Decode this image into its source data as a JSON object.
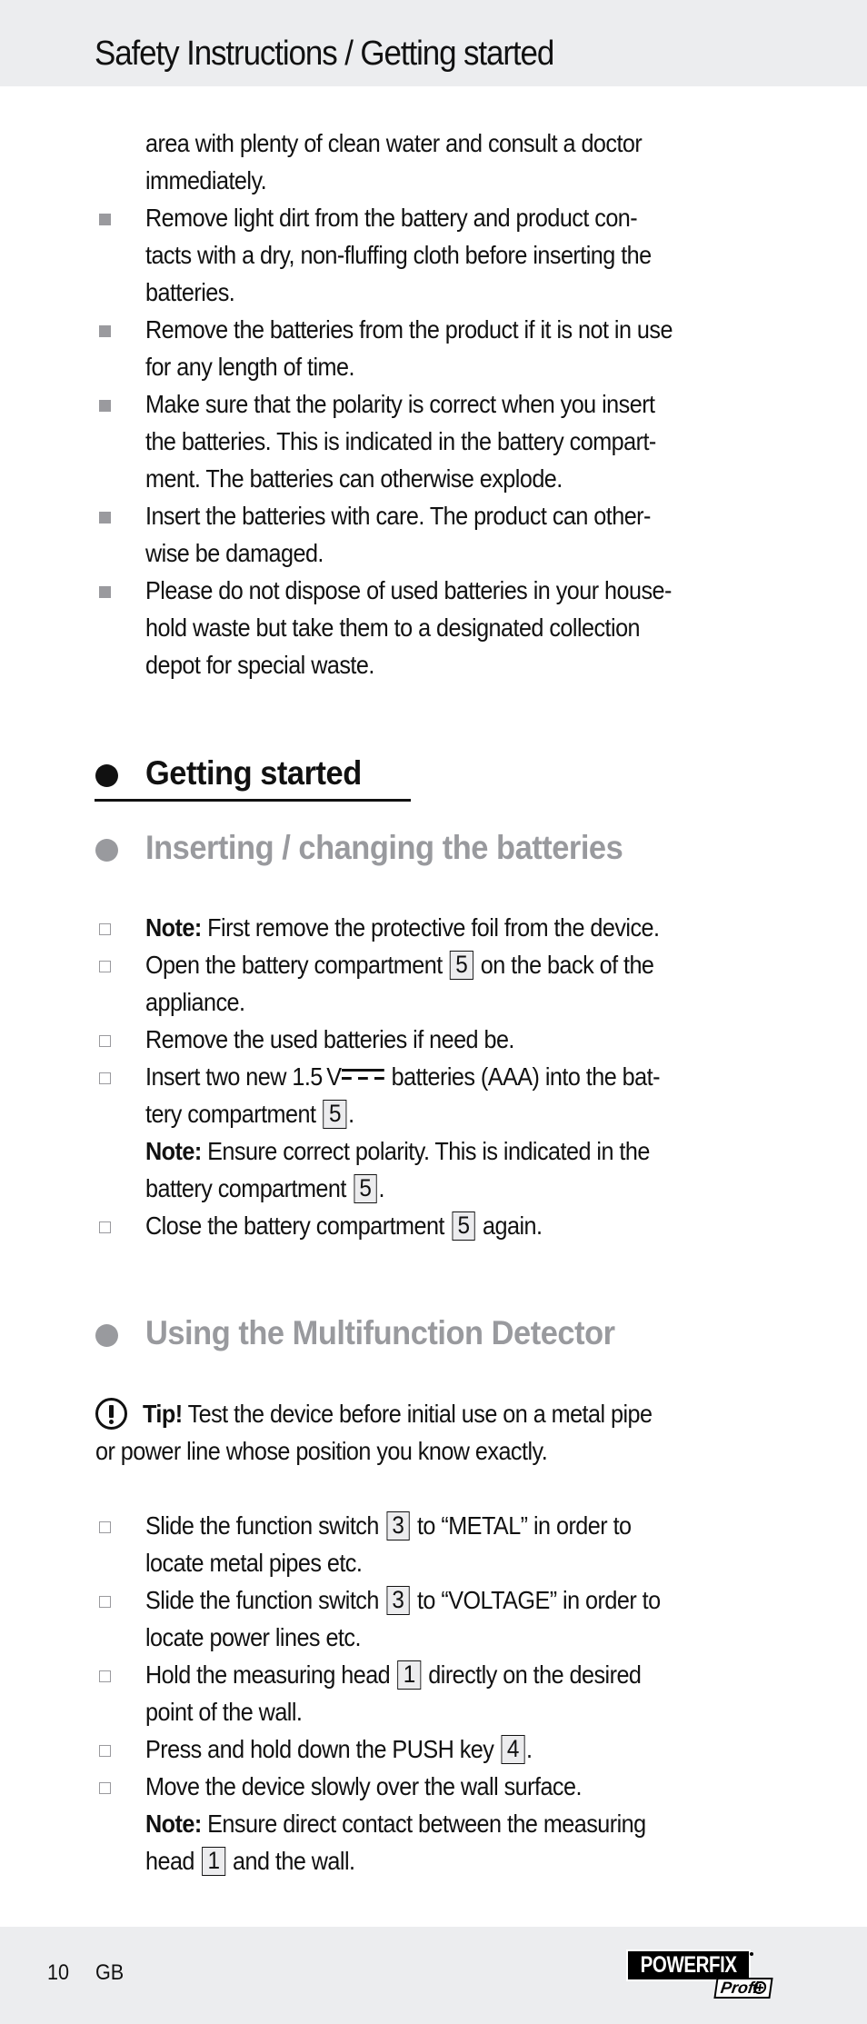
{
  "header": {
    "title": "Safety Instructions / Getting started"
  },
  "safety": {
    "continuation": {
      "lines": [
        "area with plenty of clean water and consult a doctor",
        "immediately."
      ]
    },
    "items": [
      {
        "lines": [
          "Remove light dirt from the battery and product con-",
          "tacts with a dry, non-fluffing cloth before inserting the",
          "batteries."
        ]
      },
      {
        "lines": [
          "Remove the batteries from the product if it is not in use",
          "for any length of time."
        ]
      },
      {
        "lines": [
          "Make sure that the polarity is correct when you insert",
          "the batteries. This is indicated in the battery compart-",
          "ment. The batteries can otherwise explode."
        ]
      },
      {
        "lines": [
          "Insert the batteries with care. The product can other-",
          "wise be damaged."
        ]
      },
      {
        "lines": [
          "Please do not dispose of used batteries in your house-",
          "hold waste but take them to a designated collection",
          "depot for special waste."
        ]
      }
    ]
  },
  "getting_started": {
    "heading": "Getting started"
  },
  "batteries": {
    "heading": "Inserting / changing the batteries",
    "note_label": "Note:",
    "step1_text": " First remove the protective foil from the device.",
    "step2_pre": "Open the battery compartment",
    "step2_ref": "5",
    "step2_post": "on the back of the",
    "step2_line2": "appliance.",
    "step3": "Remove the used batteries if need be.",
    "step4_pre": "Insert two new 1.5 V",
    "step4_post": "batteries (AAA) into the bat-",
    "step4_line2_pre": "tery compartment",
    "step4_ref": "5",
    "step4_line2_post": ".",
    "step4_note_label": "Note:",
    "step4_note_text": " Ensure correct polarity. This is indicated in the",
    "step4_note_line2_pre": "battery compartment",
    "step4_note_ref": "5",
    "step4_note_line2_post": ".",
    "step5_pre": "Close the battery compartment",
    "step5_ref": "5",
    "step5_post": "again."
  },
  "using": {
    "heading": "Using the Multifunction Detector",
    "tip_label": "Tip!",
    "tip_text": " Test the device before initial use on a metal pipe",
    "tip_line2": "or power line whose position you know exactly.",
    "step1_pre": "Slide the function switch",
    "step1_ref": "3",
    "step1_post": "to “METAL” in order to",
    "step1_line2": "locate metal pipes etc.",
    "step2_pre": "Slide the function switch",
    "step2_ref": "3",
    "step2_post": "to “VOLTAGE” in order to",
    "step2_line2": "locate power lines etc.",
    "step3_pre": "Hold the measuring head",
    "step3_ref": "1",
    "step3_post": "directly on the desired",
    "step3_line2": "point of the wall.",
    "step4_pre": "Press and hold down the PUSH key",
    "step4_ref": "4",
    "step4_post": ".",
    "step5": "Move the device slowly over the wall surface.",
    "step5_note_label": "Note:",
    "step5_note_text": " Ensure direct contact between the measuring",
    "step5_note_line2_pre": "head",
    "step5_note_ref": "1",
    "step5_note_line2_post": "and the wall."
  },
  "footer": {
    "page_number": "10",
    "language": "GB",
    "brand": "POWERFIX",
    "sub_brand": "Profi"
  },
  "colors": {
    "band_bg": "#ecedef",
    "heading_grey": "#999a9e",
    "bullet_grey": "#9a9a9e",
    "ref_box_bg": "#ececee"
  }
}
